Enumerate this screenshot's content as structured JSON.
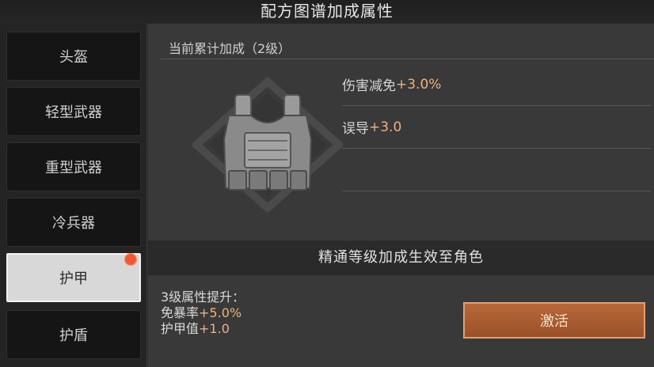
{
  "window": {
    "title": "配方图谱加成属性"
  },
  "sidebar": {
    "items": [
      {
        "label": "头盔"
      },
      {
        "label": "轻型武器"
      },
      {
        "label": "重型武器"
      },
      {
        "label": "冷兵器"
      },
      {
        "label": "护甲",
        "selected": true,
        "has_notification": true
      },
      {
        "label": "护盾"
      }
    ]
  },
  "main": {
    "section_title": "当前累计加成（2级）",
    "image_icon": "body-armor-vest-icon",
    "attributes": [
      {
        "name": "伤害减免",
        "value": "+3.0%"
      },
      {
        "name": "误导",
        "value": "+3.0"
      }
    ],
    "banner": "精通等级加成生效至角色",
    "next_level": {
      "heading": "3级属性提升：",
      "items": [
        {
          "name": "免暴率",
          "value": "+5.0%"
        },
        {
          "name": "护甲值",
          "value": "+1.0"
        }
      ]
    },
    "activate_label": "激活"
  },
  "colors": {
    "accent": "#f0b27a",
    "button": "#a95a30",
    "badge": "#f05a32"
  }
}
